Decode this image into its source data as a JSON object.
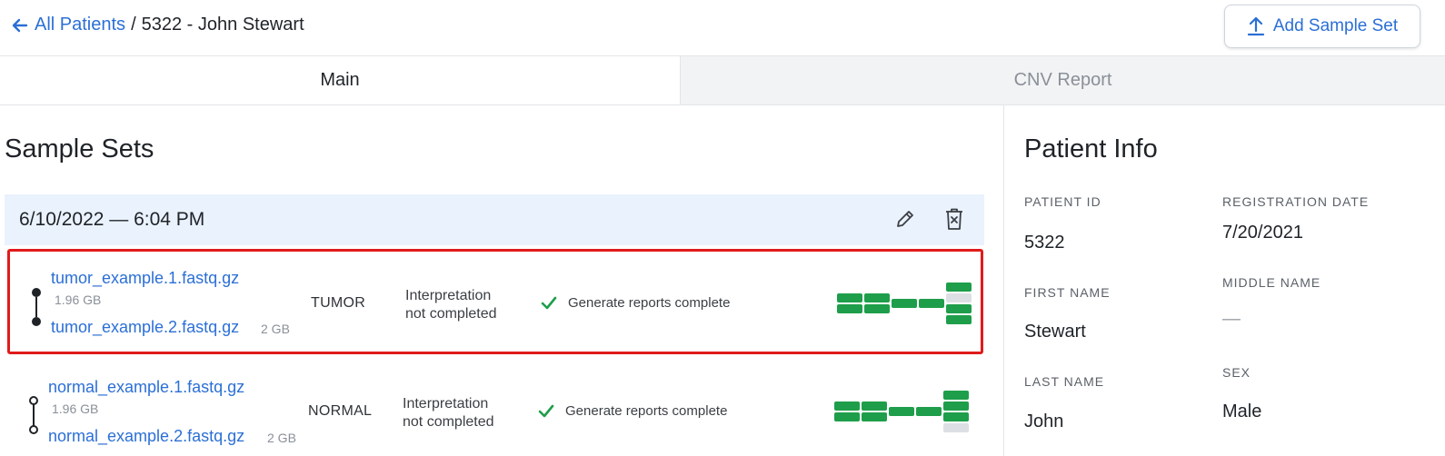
{
  "breadcrumb": {
    "back_label": "All Patients",
    "separator": "/",
    "current": "5322 - John Stewart"
  },
  "header": {
    "add_button_label": "Add Sample Set"
  },
  "tabs": [
    {
      "label": "Main",
      "active": true
    },
    {
      "label": "CNV Report",
      "active": false
    }
  ],
  "sample_sets": {
    "title": "Sample Sets",
    "set": {
      "date": "6/10/2022 — 6:04 PM",
      "rows": [
        {
          "file1": "tumor_example.1.fastq.gz",
          "size1": "1.96 GB",
          "file2": "tumor_example.2.fastq.gz",
          "size2": "2 GB",
          "type": "TUMOR",
          "interpretation_line1": "Interpretation",
          "interpretation_line2": "not completed",
          "status": "Generate reports complete",
          "highlighted": true
        },
        {
          "file1": "normal_example.1.fastq.gz",
          "size1": "1.96 GB",
          "file2": "normal_example.2.fastq.gz",
          "size2": "2 GB",
          "type": "NORMAL",
          "interpretation_line1": "Interpretation",
          "interpretation_line2": "not completed",
          "status": "Generate reports complete",
          "highlighted": false
        }
      ]
    }
  },
  "patient_info": {
    "title": "Patient Info",
    "patient_id_label": "PATIENT ID",
    "patient_id": "5322",
    "registration_date_label": "REGISTRATION DATE",
    "registration_date": "7/20/2021",
    "first_name_label": "FIRST NAME",
    "first_name": "Stewart",
    "middle_name_label": "MIDDLE NAME",
    "middle_name": "—",
    "last_name_label": "LAST NAME",
    "last_name": "John",
    "sex_label": "SEX",
    "sex": "Male"
  },
  "colors": {
    "link": "#2b6fd6",
    "success": "#1e9e4a",
    "highlight": "#e01b1b",
    "set_header_bg": "#eaf2fd",
    "incomplete": "#dcdfe3"
  }
}
